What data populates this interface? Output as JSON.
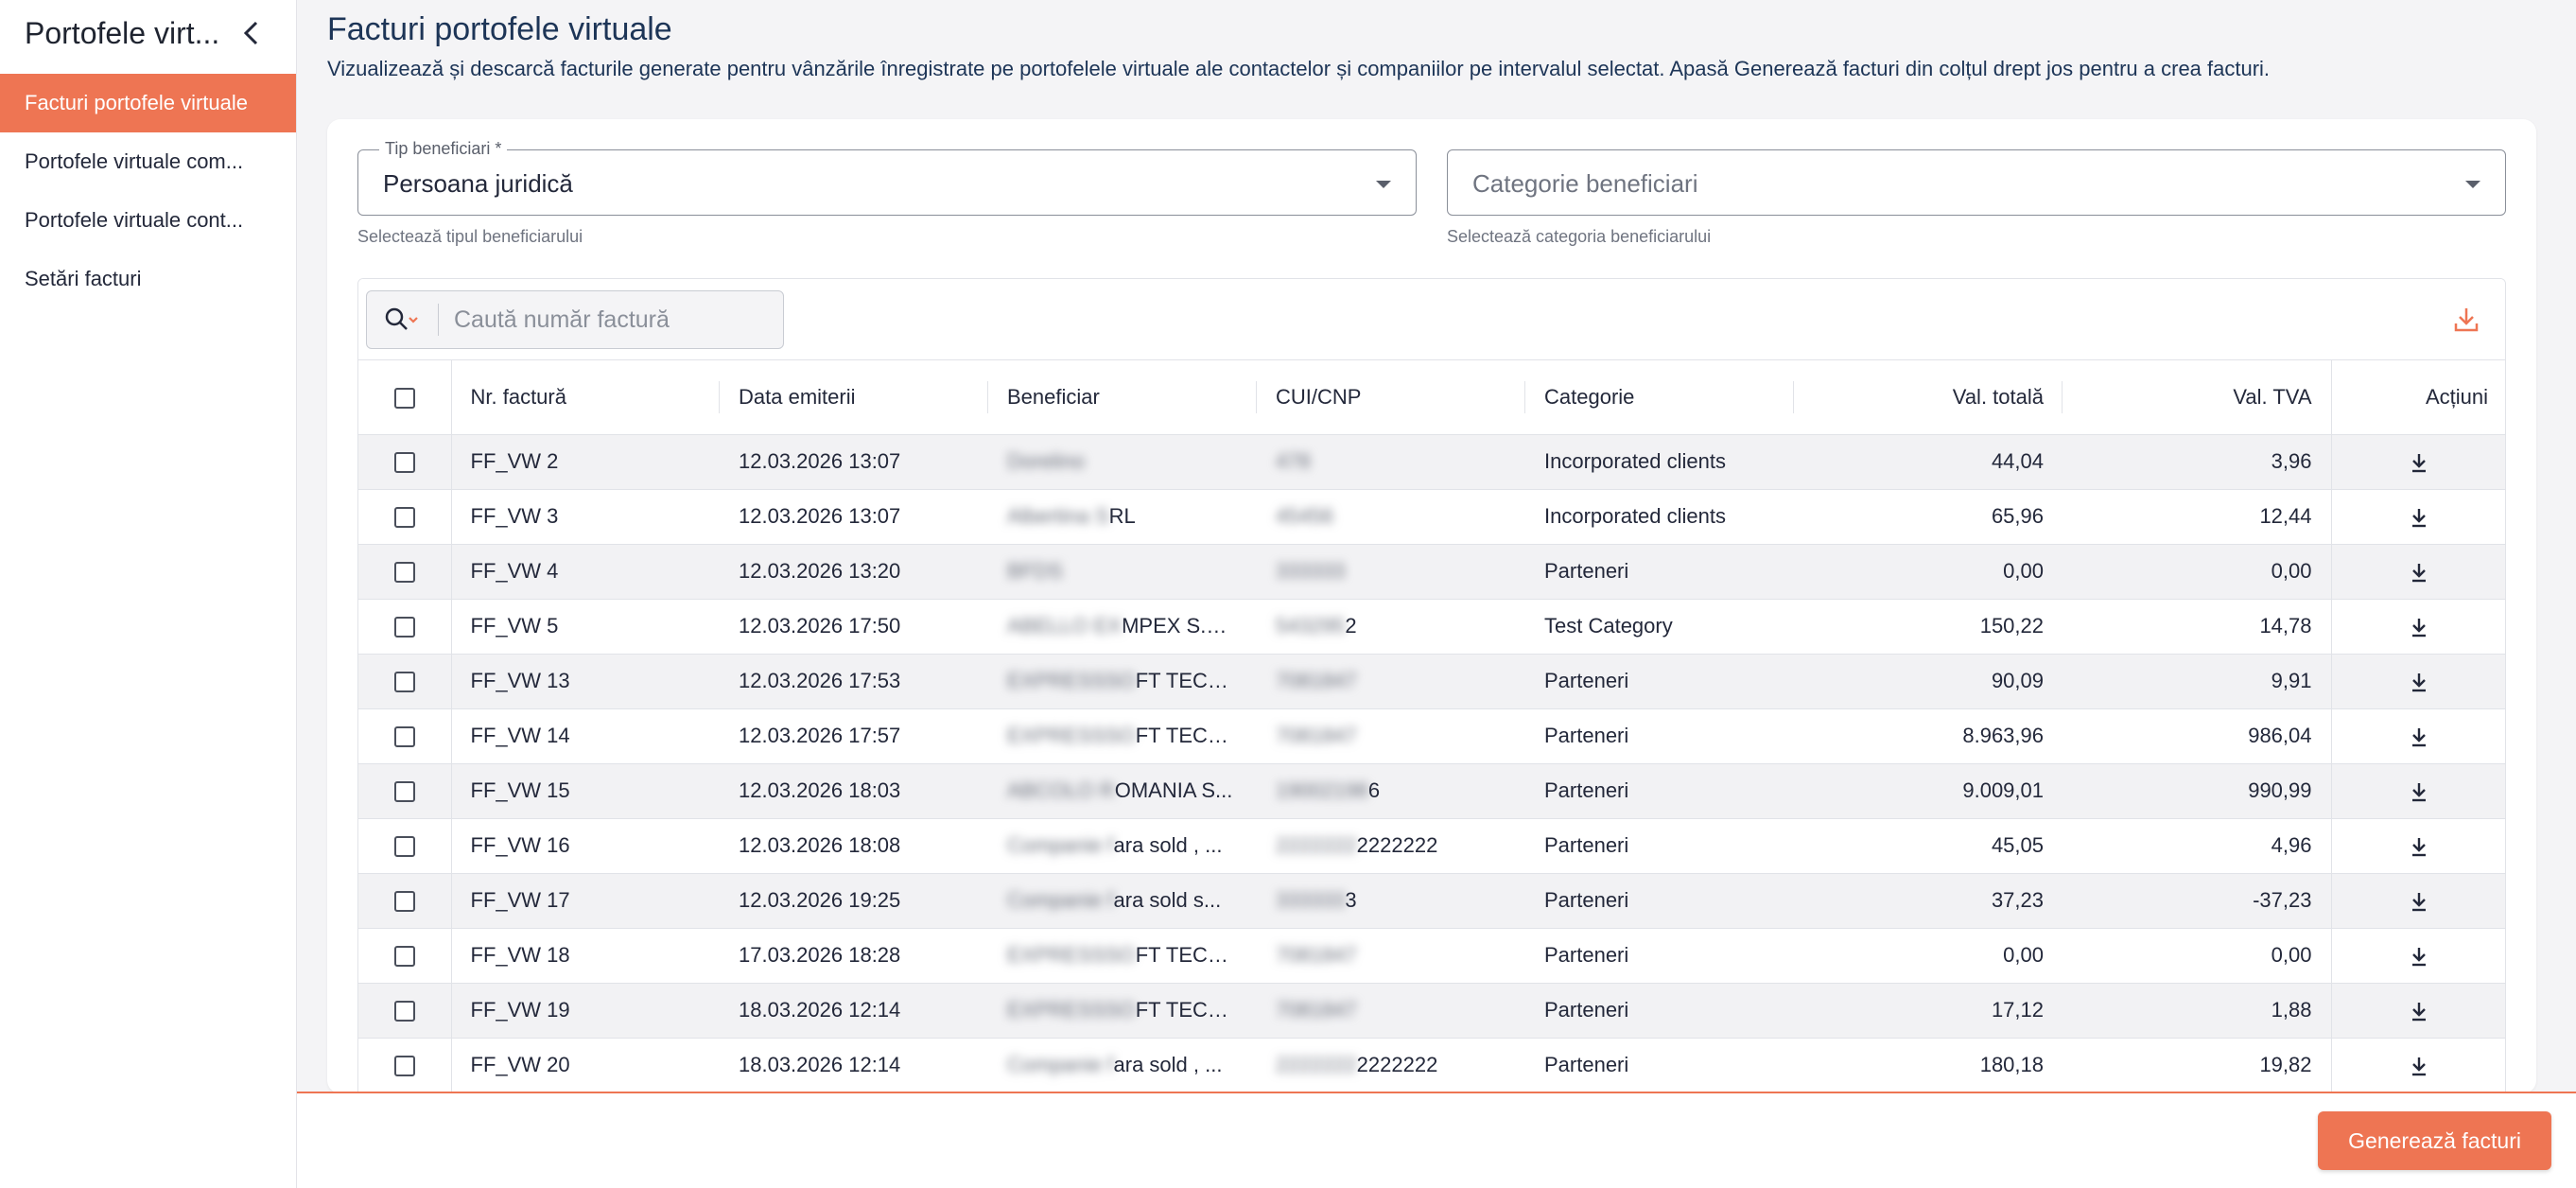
{
  "sidebar": {
    "title": "Portofele virt...",
    "items": [
      {
        "label": "Facturi portofele virtuale",
        "active": true
      },
      {
        "label": "Portofele virtuale com...",
        "active": false
      },
      {
        "label": "Portofele virtuale cont...",
        "active": false
      },
      {
        "label": "Setări facturi",
        "active": false
      }
    ]
  },
  "header": {
    "title": "Facturi portofele virtuale",
    "description": "Vizualizează și descarcă facturile generate pentru vânzările înregistrate pe portofelele virtuale ale contactelor și companiilor pe intervalul selectat. Apasă Generează facturi din colțul drept jos pentru a crea facturi."
  },
  "filters": {
    "beneficiary_type": {
      "label": "Tip beneficiari *",
      "value": "Persoana juridică",
      "helper": "Selectează tipul beneficiarului"
    },
    "beneficiary_category": {
      "placeholder": "Categorie beneficiari",
      "helper": "Selectează categoria beneficiarului"
    }
  },
  "search": {
    "placeholder": "Caută număr factură"
  },
  "table": {
    "columns": [
      "Nr. factură",
      "Data emiterii",
      "Beneficiar",
      "CUI/CNP",
      "Categorie",
      "Val. totală",
      "Val. TVA",
      "Acțiuni"
    ],
    "rows": [
      {
        "nr": "FF_VW 2",
        "date": "12.03.2026 13:07",
        "beneficiar_hidden": "Dorelino",
        "beneficiar_visible": "",
        "cui_hidden": "478",
        "cui_visible": "",
        "category": "Incorporated clients",
        "total": "44,04",
        "tva": "3,96"
      },
      {
        "nr": "FF_VW 3",
        "date": "12.03.2026 13:07",
        "beneficiar_hidden": "Albertina S",
        "beneficiar_visible": "RL",
        "cui_hidden": "45456",
        "cui_visible": "",
        "category": "Incorporated clients",
        "total": "65,96",
        "tva": "12,44"
      },
      {
        "nr": "FF_VW 4",
        "date": "12.03.2026 13:20",
        "beneficiar_hidden": "BFDS",
        "beneficiar_visible": "",
        "cui_hidden": "333333",
        "cui_visible": "",
        "category": "Parteneri",
        "total": "0,00",
        "tva": "0,00"
      },
      {
        "nr": "FF_VW 5",
        "date": "12.03.2026 17:50",
        "beneficiar_hidden": "ABELLO EX",
        "beneficiar_visible": "MPEX S.R...",
        "cui_hidden": "543295",
        "cui_visible": "2",
        "category": "Test Category",
        "total": "150,22",
        "tva": "14,78"
      },
      {
        "nr": "FF_VW 13",
        "date": "12.03.2026 17:53",
        "beneficiar_hidden": "EXPRESSSO",
        "beneficiar_visible": "FT TECH...",
        "cui_hidden": "7081847",
        "cui_visible": "",
        "category": "Parteneri",
        "total": "90,09",
        "tva": "9,91"
      },
      {
        "nr": "FF_VW 14",
        "date": "12.03.2026 17:57",
        "beneficiar_hidden": "EXPRESSSO",
        "beneficiar_visible": "FT TECH...",
        "cui_hidden": "7081847",
        "cui_visible": "",
        "category": "Parteneri",
        "total": "8.963,96",
        "tva": "986,04"
      },
      {
        "nr": "FF_VW 15",
        "date": "12.03.2026 18:03",
        "beneficiar_hidden": "ABCOLO R",
        "beneficiar_visible": "OMANIA S...",
        "cui_hidden": "19002198",
        "cui_visible": "6",
        "category": "Parteneri",
        "total": "9.009,01",
        "tva": "990,99"
      },
      {
        "nr": "FF_VW 16",
        "date": "12.03.2026 18:08",
        "beneficiar_hidden": "Companie f",
        "beneficiar_visible": "ara sold , ...",
        "cui_hidden": "2222222",
        "cui_visible": "2222222",
        "category": "Parteneri",
        "total": "45,05",
        "tva": "4,96"
      },
      {
        "nr": "FF_VW 17",
        "date": "12.03.2026 19:25",
        "beneficiar_hidden": "Companie f",
        "beneficiar_visible": "ara sold s...",
        "cui_hidden": "333333",
        "cui_visible": "3",
        "category": "Parteneri",
        "total": "37,23",
        "tva": "-37,23"
      },
      {
        "nr": "FF_VW 18",
        "date": "17.03.2026 18:28",
        "beneficiar_hidden": "EXPRESSSO",
        "beneficiar_visible": "FT TECH...",
        "cui_hidden": "7081847",
        "cui_visible": "",
        "category": "Parteneri",
        "total": "0,00",
        "tva": "0,00"
      },
      {
        "nr": "FF_VW 19",
        "date": "18.03.2026 12:14",
        "beneficiar_hidden": "EXPRESSSO",
        "beneficiar_visible": "FT TECH...",
        "cui_hidden": "7081847",
        "cui_visible": "",
        "category": "Parteneri",
        "total": "17,12",
        "tva": "1,88"
      },
      {
        "nr": "FF_VW 20",
        "date": "18.03.2026 12:14",
        "beneficiar_hidden": "Companie f",
        "beneficiar_visible": "ara sold , ...",
        "cui_hidden": "2222222",
        "cui_visible": "2222222",
        "category": "Parteneri",
        "total": "180,18",
        "tva": "19,82"
      }
    ]
  },
  "footer": {
    "generate_label": "Generează facturi"
  },
  "icons": {
    "collapse": "chevron-left-icon",
    "search": "search-icon",
    "export": "download-tray-icon",
    "row_action": "download-icon"
  },
  "colors": {
    "accent": "#ee7553",
    "title": "#1d3557"
  }
}
